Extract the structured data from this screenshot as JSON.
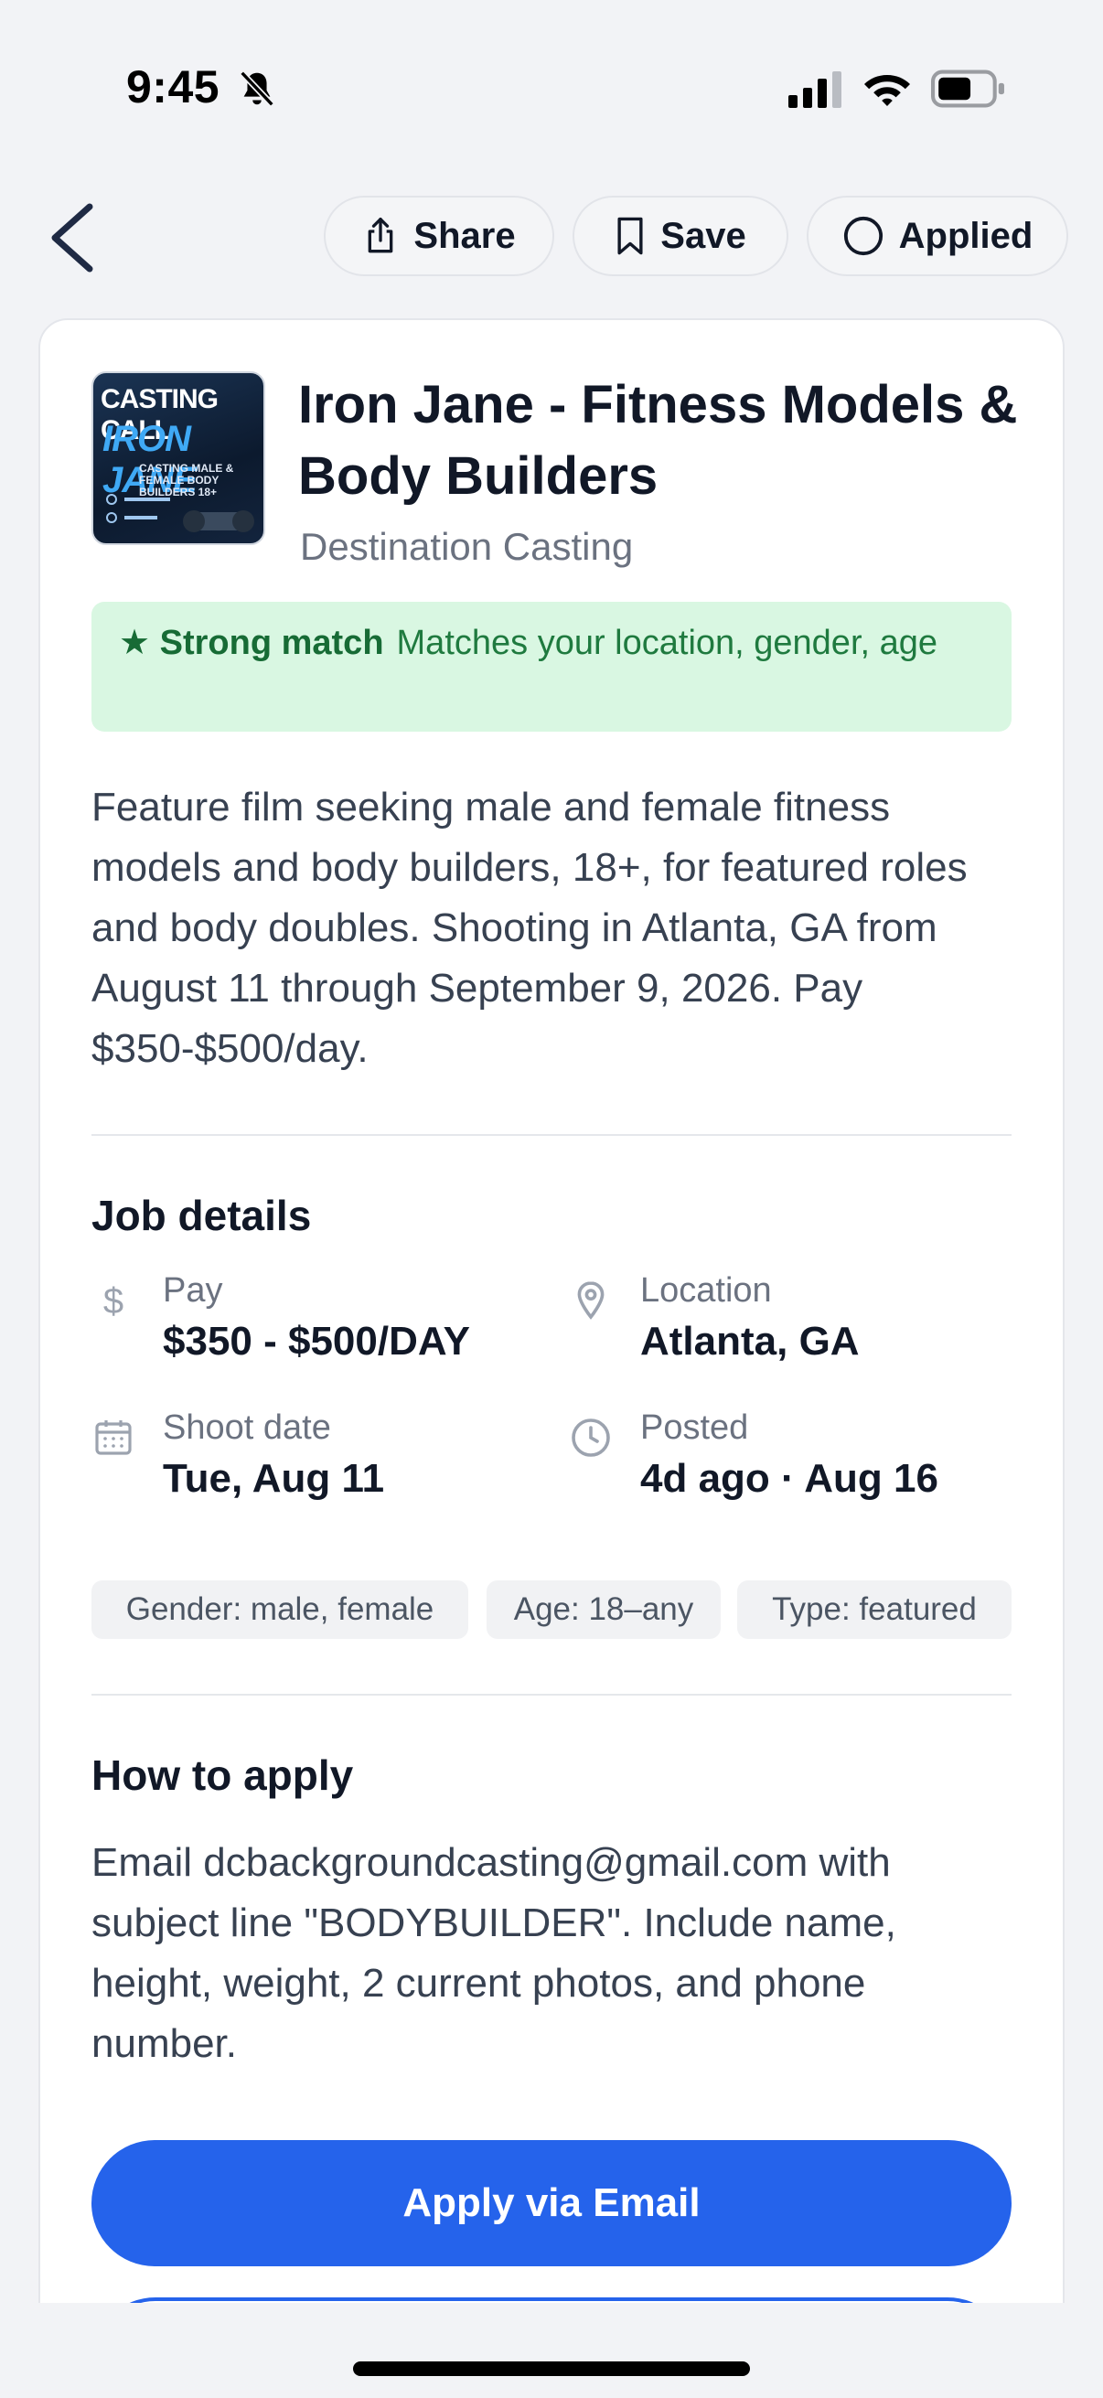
{
  "status_bar": {
    "time": "9:45",
    "icons": [
      "bell-slash-icon",
      "cellular-signal-icon",
      "wifi-icon",
      "battery-icon"
    ]
  },
  "toolbar": {
    "back_icon": "chevron-left-icon",
    "share_label": "Share",
    "save_label": "Save",
    "applied_label": "Applied"
  },
  "job": {
    "thumbnail": {
      "line1": "CASTING CALL",
      "line2": "IRON JANE",
      "line3": "CASTING MALE & FEMALE BODY BUILDERS 18+"
    },
    "title": "Iron Jane - Fitness Models & Body Builders",
    "company": "Destination Casting",
    "match": {
      "label": "★ Strong match",
      "text": "Matches your location, gender, age"
    },
    "description": "Feature film seeking male and female fitness models and body builders, 18+, for featured roles and body doubles. Shooting in Atlanta, GA from August 11 through September 9, 2026. Pay $350-$500/day."
  },
  "details": {
    "title": "Job details",
    "pay": {
      "label": "Pay",
      "value": "$350 - $500/DAY",
      "icon": "dollar-icon"
    },
    "location": {
      "label": "Location",
      "value": "Atlanta, GA",
      "icon": "map-pin-icon"
    },
    "shoot_date": {
      "label": "Shoot date",
      "value": "Tue, Aug 11",
      "icon": "calendar-icon"
    },
    "posted": {
      "label": "Posted",
      "value": "4d ago · Aug 16",
      "icon": "clock-icon"
    },
    "tags": [
      "Gender: male, female",
      "Age: 18–any",
      "Type: featured"
    ]
  },
  "how_to_apply": {
    "title": "How to apply",
    "text": "Email dcbackgroundcasting@gmail.com with subject line \"BODYBUILDER\". Include name, height, weight, 2 current photos, and phone number.",
    "button_label": "Apply via Email"
  },
  "colors": {
    "accent": "#2563eb",
    "match_bg": "#d9f7e2",
    "match_text": "#1f7a3f",
    "page_bg": "#f2f3f6"
  }
}
